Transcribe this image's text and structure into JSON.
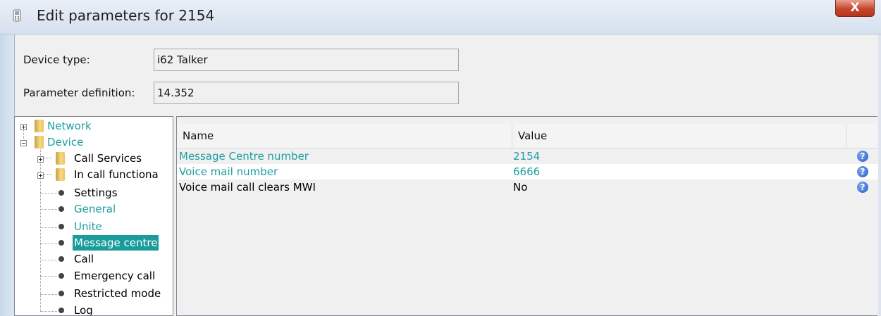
{
  "window": {
    "title": "Edit parameters for 2154",
    "close_label": "X"
  },
  "form": {
    "device_type_label": "Device type:",
    "device_type_value": "i62 Talker",
    "param_def_label": "Parameter definition:",
    "param_def_value": "14.352"
  },
  "tree": {
    "network": "Network",
    "device": "Device",
    "call_services": "Call Services",
    "in_call": "In call functiona",
    "settings": "Settings",
    "general": "General",
    "unite": "Unite",
    "message_centre": "Message centre",
    "call": "Call",
    "emergency_call": "Emergency call",
    "restricted_mode": "Restricted mode",
    "log": "Log"
  },
  "table": {
    "headers": [
      "Name",
      "Value"
    ],
    "rows": [
      {
        "name": "Message Centre number",
        "value": "2154",
        "modified": true
      },
      {
        "name": "Voice mail number",
        "value": "6666",
        "modified": true
      },
      {
        "name": "Voice mail call clears MWI",
        "value": "No",
        "modified": false
      }
    ],
    "help_glyph": "?"
  },
  "colors": {
    "modified": "#1f9ea0",
    "selection": "#1a9c9c",
    "close": "#c6452d"
  }
}
